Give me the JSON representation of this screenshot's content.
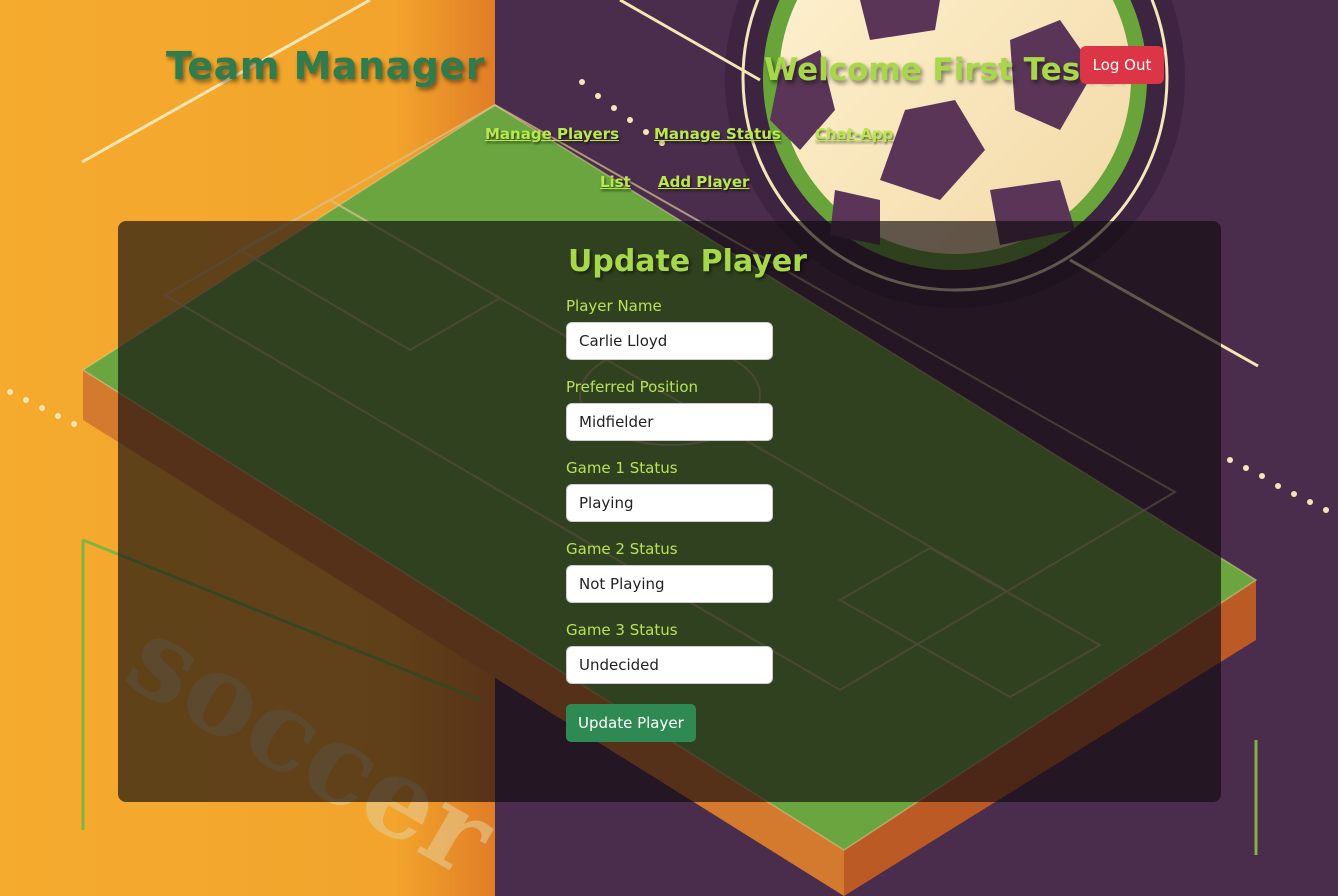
{
  "header": {
    "title": "Team Manager",
    "welcome": "Welcome First Tester",
    "logout_label": "Log Out"
  },
  "nav": {
    "manage_players": "Manage Players",
    "manage_status": "Manage Status",
    "chat_app": "Chat-App",
    "list": "List",
    "add_player": "Add Player"
  },
  "form": {
    "heading": "Update Player",
    "fields": [
      {
        "label": "Player Name",
        "value": "Carlie Lloyd"
      },
      {
        "label": "Preferred Position",
        "value": "Midfielder"
      },
      {
        "label": "Game 1 Status",
        "value": "Playing"
      },
      {
        "label": "Game 2 Status",
        "value": "Not Playing"
      },
      {
        "label": "Game 3 Status",
        "value": "Undecided"
      }
    ],
    "submit_label": "Update Player"
  },
  "background": {
    "watermark": "soccer"
  },
  "colors": {
    "accent": "#a7d84a",
    "title": "#2f7d4e",
    "danger": "#dc3545",
    "success": "#2e8a52",
    "orange_panel": "#f2a82f",
    "purple_bg": "#4a2d4c"
  }
}
